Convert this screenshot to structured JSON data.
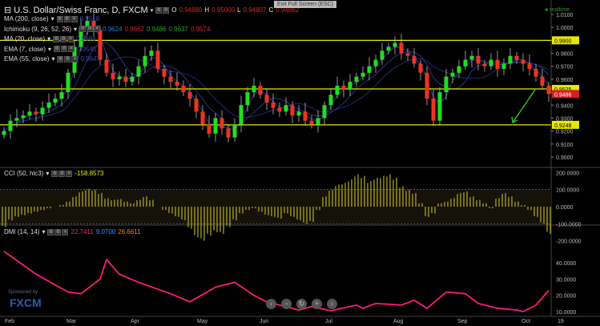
{
  "header": {
    "title": "U.S. Dollar/Swiss Franc, D, FXCM",
    "ohlc": {
      "o_label": "O",
      "o": "0.94880",
      "h_label": "H",
      "h": "0.95000",
      "l_label": "L",
      "l": "0.94807",
      "c_label": "C",
      "c": "0.94862"
    }
  },
  "exit_fullscreen": "Exit Full Screen (ESC)",
  "realtime": "realtime",
  "indicators": [
    {
      "name": "MA (200, close)",
      "values": [
        "0.9518"
      ]
    },
    {
      "name": "Ichimoku (9, 26, 52, 26)",
      "values": [
        "0.9624",
        "0.9662",
        "0.9486",
        "0.9637",
        "0.9574"
      ]
    },
    {
      "name": "MA (20, close)",
      "values": [
        "0.9688"
      ]
    },
    {
      "name": "EMA (7, close)",
      "values": [
        "0.9545"
      ]
    },
    {
      "name": "EMA (55, close)",
      "values": [
        "0.9647"
      ]
    }
  ],
  "price_axis": [
    "1.0100",
    "1.0000",
    "0.9900",
    "0.9800",
    "0.9700",
    "0.9600",
    "0.9500",
    "0.9400",
    "0.9300",
    "0.9200",
    "0.9100",
    "0.9000"
  ],
  "levels": [
    {
      "value": 0.99,
      "label": "0.9900"
    },
    {
      "value": 0.9525,
      "label": "0.9525"
    },
    {
      "value": 0.9248,
      "label": "0.9248"
    }
  ],
  "current_price": {
    "value": 0.9486,
    "label": "0.9486"
  },
  "closes": [
    0.92,
    0.928,
    0.93,
    0.932,
    0.935,
    0.933,
    0.938,
    0.942,
    0.945,
    0.95,
    0.965,
    0.985,
    1.0,
    1.005,
    0.998,
    0.975,
    0.965,
    0.96,
    0.962,
    0.958,
    0.962,
    0.97,
    0.978,
    0.982,
    0.968,
    0.962,
    0.958,
    0.955,
    0.95,
    0.945,
    0.935,
    0.925,
    0.918,
    0.93,
    0.922,
    0.915,
    0.925,
    0.94,
    0.95,
    0.955,
    0.948,
    0.942,
    0.938,
    0.935,
    0.94,
    0.932,
    0.935,
    0.928,
    0.925,
    0.93,
    0.94,
    0.948,
    0.955,
    0.952,
    0.958,
    0.962,
    0.965,
    0.97,
    0.975,
    0.982,
    0.985,
    0.988,
    0.98,
    0.978,
    0.972,
    0.965,
    0.945,
    0.928,
    0.95,
    0.962,
    0.965,
    0.97,
    0.975,
    0.978,
    0.972,
    0.97,
    0.975,
    0.968,
    0.972,
    0.978,
    0.975,
    0.972,
    0.968,
    0.962,
    0.955,
    0.9486
  ],
  "cci": {
    "label": "CCI (50, hlc3)",
    "value": "-158.8573",
    "axis": [
      "200.0000",
      "100.0000",
      "0.0000",
      "-100.0000",
      "-200.0000"
    ],
    "values": [
      -120,
      -80,
      -60,
      -50,
      -40,
      -30,
      -20,
      -10,
      0,
      10,
      30,
      60,
      90,
      105,
      100,
      80,
      50,
      40,
      45,
      30,
      20,
      40,
      60,
      40,
      0,
      -20,
      -40,
      -60,
      -80,
      -130,
      -180,
      -200,
      -170,
      -150,
      -160,
      -120,
      -80,
      -40,
      -20,
      -10,
      -30,
      -50,
      -60,
      -70,
      -40,
      -60,
      -80,
      -100,
      -90,
      -20,
      60,
      100,
      130,
      140,
      160,
      190,
      180,
      150,
      170,
      180,
      190,
      170,
      120,
      100,
      80,
      20,
      -60,
      -40,
      20,
      30,
      50,
      80,
      90,
      60,
      40,
      20,
      -10,
      50,
      80,
      60,
      30,
      10,
      -20,
      -60,
      -100,
      -159
    ]
  },
  "dmi": {
    "label": "DMI (14, 14)",
    "values": [
      "22.7411",
      "9.0700",
      "26.6611"
    ],
    "axis": [
      "40.0000",
      "30.0000",
      "20.0000",
      "10.0000"
    ],
    "points": [
      [
        0,
        47
      ],
      [
        5,
        33
      ],
      [
        10,
        22
      ],
      [
        12,
        21
      ],
      [
        15,
        30
      ],
      [
        16,
        42
      ],
      [
        18,
        33
      ],
      [
        21,
        28
      ],
      [
        26,
        21
      ],
      [
        29,
        16
      ],
      [
        33,
        25
      ],
      [
        36,
        28
      ],
      [
        39,
        20
      ],
      [
        41,
        16
      ],
      [
        46,
        11
      ],
      [
        48,
        13
      ],
      [
        51,
        10.5
      ],
      [
        55,
        14
      ],
      [
        56,
        12
      ],
      [
        58,
        15
      ],
      [
        62,
        14
      ],
      [
        64,
        17
      ],
      [
        66,
        12
      ],
      [
        69,
        22
      ],
      [
        72,
        21
      ],
      [
        74,
        15
      ],
      [
        77,
        12
      ],
      [
        80,
        11
      ],
      [
        81,
        10
      ],
      [
        83,
        14
      ],
      [
        85,
        23
      ]
    ]
  },
  "x_axis": [
    "Feb",
    "Mar",
    "Apr",
    "May",
    "Jun",
    "Jul",
    "Aug",
    "Sep",
    "Oct",
    "19"
  ],
  "sponsor": {
    "text": "Sponsored by",
    "brand": "FXCM"
  },
  "nav": [
    "‹",
    "−",
    "↻",
    "+",
    "›"
  ],
  "colors": {
    "up": "#22dd22",
    "down": "#ee3322",
    "level": "#e8e800",
    "ma": "#2a3a9a",
    "cci": "#b8b020",
    "dmi": "#ff1a7a"
  }
}
